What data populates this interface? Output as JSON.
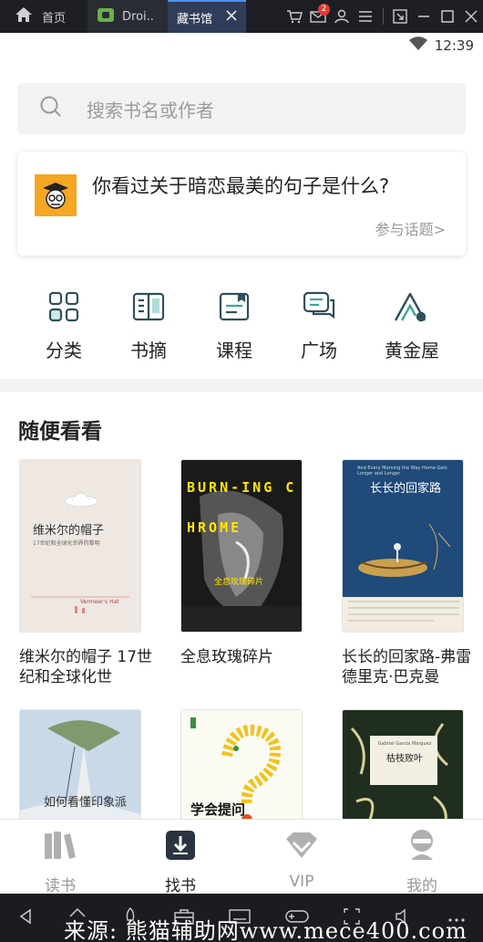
{
  "topbar": {
    "tabs": [
      {
        "label": "首页",
        "icon": "home-icon"
      },
      {
        "label": "Droi..",
        "icon": "android-icon"
      },
      {
        "label": "藏书馆",
        "icon": "close-icon"
      }
    ],
    "mail_badge": "2"
  },
  "status": {
    "time": "12:39"
  },
  "search": {
    "placeholder": "搜索书名或作者"
  },
  "topic": {
    "question": "你看过关于暗恋最美的句子是什么?",
    "join": "参与话题>"
  },
  "quicknav": [
    {
      "label": "分类",
      "icon": "category-grid-icon"
    },
    {
      "label": "书摘",
      "icon": "book-excerpt-icon"
    },
    {
      "label": "课程",
      "icon": "course-icon"
    },
    {
      "label": "广场",
      "icon": "chat-square-icon"
    },
    {
      "label": "黄金屋",
      "icon": "gold-house-icon"
    }
  ],
  "section_title": "随便看看",
  "books": [
    {
      "title": "维米尔的帽子 17世纪和全球化世",
      "cover_title": "维米尔的帽子",
      "cover_sub": "17世纪和全球化世界的黎明",
      "cover_en": "Vermeer's Hat"
    },
    {
      "title": "全息玫瑰碎片",
      "cover_title": "BURN-ING CHROME",
      "cover_sub": "全息玫瑰碎片"
    },
    {
      "title": "长长的回家路-弗雷德里克·巴克曼",
      "cover_title": "长长的回家路",
      "cover_en": "And Every Morning the Way Home Gets Longer and Longer"
    },
    {
      "title": "",
      "cover_title": "如何看懂印象派"
    },
    {
      "title": "",
      "cover_title": "学会提问"
    },
    {
      "title": "",
      "cover_title": "枯枝败叶",
      "cover_en": "Gabriel García Márquez"
    }
  ],
  "bottomnav": [
    {
      "label": "读书",
      "icon": "books-icon"
    },
    {
      "label": "找书",
      "icon": "find-book-icon"
    },
    {
      "label": "VIP",
      "icon": "diamond-icon"
    },
    {
      "label": "我的",
      "icon": "profile-icon"
    }
  ],
  "watermark": "来源: 熊猫辅助网www.mece400.com",
  "colors": {
    "accent": "#3aa7a0",
    "topic_avatar": "#f5a623",
    "active_tab": "#2f3d5a"
  }
}
